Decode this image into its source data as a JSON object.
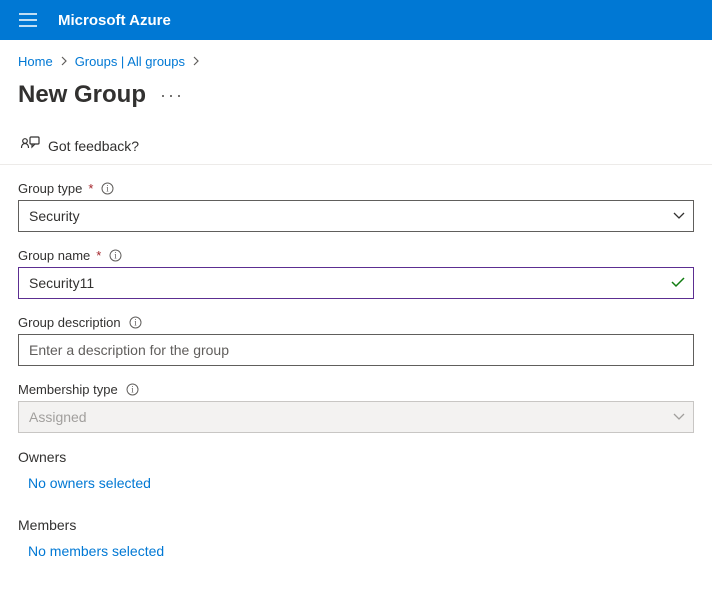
{
  "header": {
    "brand": "Microsoft Azure"
  },
  "breadcrumb": {
    "items": [
      "Home",
      "Groups | All groups"
    ]
  },
  "page": {
    "title": "New Group"
  },
  "feedback": {
    "label": "Got feedback?"
  },
  "form": {
    "group_type": {
      "label": "Group type",
      "value": "Security",
      "required": true
    },
    "group_name": {
      "label": "Group name",
      "value": "Security11",
      "required": true
    },
    "group_description": {
      "label": "Group description",
      "placeholder": "Enter a description for the group",
      "value": ""
    },
    "membership_type": {
      "label": "Membership type",
      "value": "Assigned"
    },
    "owners": {
      "heading": "Owners",
      "link": "No owners selected"
    },
    "members": {
      "heading": "Members",
      "link": "No members selected"
    }
  }
}
